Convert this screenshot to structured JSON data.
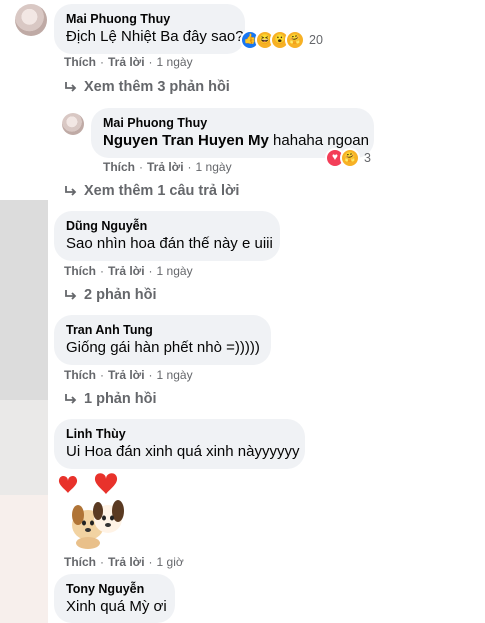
{
  "comments": [
    {
      "author": "Mai Phuong Thuy",
      "text": "Địch Lệ Nhiệt Ba đây sao?",
      "reaction_count": "20",
      "like": "Thích",
      "reply": "Trả lời",
      "time": "1 ngày",
      "more_replies": "Xem thêm 3 phản hồi"
    },
    {
      "author": "Mai Phuong Thuy",
      "mention": "Nguyen Tran Huyen My",
      "text": " hahaha ngoan",
      "reaction_count": "3",
      "like": "Thích",
      "reply": "Trả lời",
      "time": "1 ngày",
      "more_replies": "Xem thêm 1 câu trả lời"
    },
    {
      "author": "Dũng Nguyễn",
      "text": "Sao nhìn hoa đán thế này e uiii",
      "like": "Thích",
      "reply": "Trả lời",
      "time": "1 ngày",
      "more_replies": "2 phản hồi"
    },
    {
      "author": "Tran Anh Tung",
      "text": "Giống gái hàn phết nhò =)))))",
      "like": "Thích",
      "reply": "Trả lời",
      "time": "1 ngày",
      "more_replies": "1 phản hồi"
    },
    {
      "author": "Linh Thùy",
      "text": "Ui Hoa đán xinh quá xinh nàyyyyyy",
      "like": "Thích",
      "reply": "Trả lời",
      "time": "1 giờ"
    },
    {
      "author": "Tony Nguyễn",
      "text": "Xinh quá Mỳ ơi"
    }
  ],
  "icons": {
    "reply_arrow": "reply-arrow-icon",
    "sticker": "dogs-hearts-sticker"
  }
}
